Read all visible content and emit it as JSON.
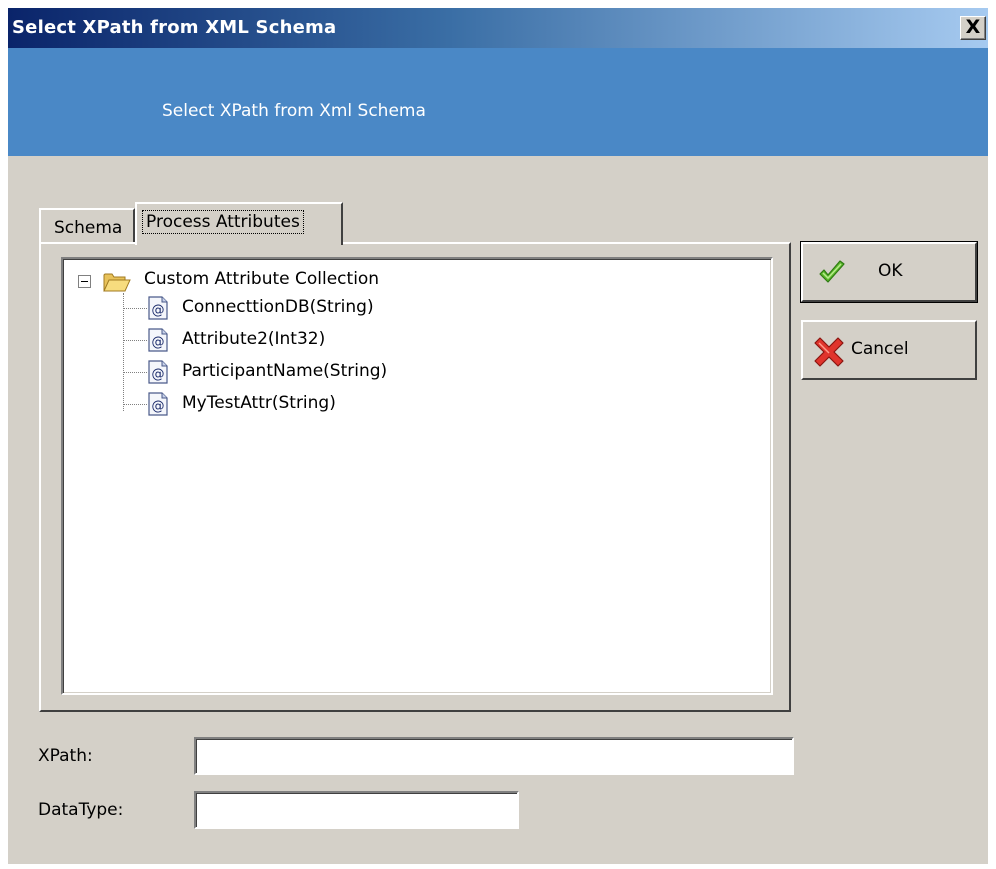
{
  "window": {
    "title": "Select XPath from XML Schema",
    "close_glyph": "X"
  },
  "banner": {
    "text": "Select XPath from Xml Schema",
    "color": "#4a88c6"
  },
  "tabs": [
    {
      "label": "Schema",
      "selected": false
    },
    {
      "label": "Process Attributes",
      "selected": true
    }
  ],
  "tree": {
    "root": {
      "label": "Custom Attribute Collection",
      "icon": "folder-open-icon",
      "expanded": true
    },
    "children": [
      {
        "label": "ConnecttionDB(String)",
        "icon": "attribute-icon"
      },
      {
        "label": "Attribute2(Int32)",
        "icon": "attribute-icon"
      },
      {
        "label": "ParticipantName(String)",
        "icon": "attribute-icon"
      },
      {
        "label": "MyTestAttr(String)",
        "icon": "attribute-icon"
      }
    ]
  },
  "buttons": {
    "ok": {
      "label": "OK",
      "icon": "checkmark-icon"
    },
    "cancel": {
      "label": "Cancel",
      "icon": "red-x-icon"
    }
  },
  "fields": {
    "xpath": {
      "label": "XPath:",
      "value": ""
    },
    "datatype": {
      "label": "DataType:",
      "value": ""
    }
  }
}
